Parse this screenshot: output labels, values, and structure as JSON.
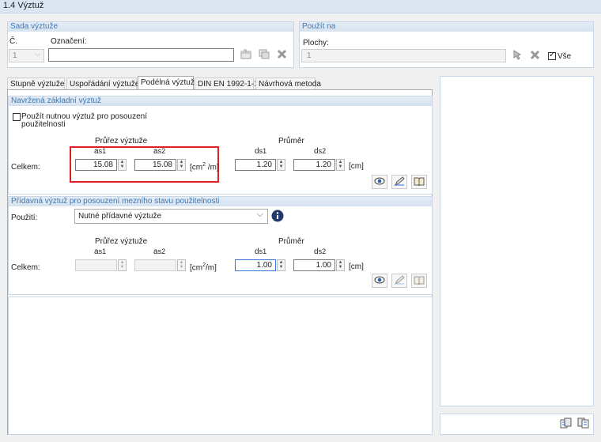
{
  "window": {
    "title": "1.4 Výztuž"
  },
  "set": {
    "header": "Sada výztuže",
    "number_label": "Č.",
    "number_value": "1",
    "designation_label": "Označení:",
    "designation_value": ""
  },
  "apply": {
    "header": "Použít na",
    "surfaces_label": "Plochy:",
    "surfaces_value": "1",
    "all_label": "Vše",
    "all_checked": true
  },
  "tabs": [
    {
      "label": "Stupně výztuže"
    },
    {
      "label": "Uspořádání výztuže"
    },
    {
      "label": "Podélná výztuž"
    },
    {
      "label": "DIN EN 1992-1-1"
    },
    {
      "label": "Návrhová metoda"
    }
  ],
  "active_tab": "Podélná výztuž",
  "basic": {
    "header": "Navržená základní výztuž",
    "use_required_label_1": "Použít nutnou výztuž pro posouzení",
    "use_required_label_2": "použitelnosti",
    "use_required_checked": false,
    "section_label": "Průřez výztuže",
    "diameter_label": "Průměr",
    "as1_main": "a",
    "as1_sub": "s1",
    "as2_main": "a",
    "as2_sub": "s2",
    "ds1_main": "d",
    "ds1_sub": "s1",
    "ds2_main": "d",
    "ds2_sub": "s2",
    "total_label": "Celkem:",
    "as1_value": "15.08",
    "as2_value": "15.08",
    "area_unit_pre": "[cm",
    "area_unit_sup": "2",
    "area_unit_post": " /m]",
    "ds1_value": "1.20",
    "ds2_value": "1.20",
    "diam_unit": "[cm]"
  },
  "additional": {
    "header": "Přídavná výztuž pro posouzení mezního stavu použitelnosti",
    "use_label": "Použití:",
    "use_value": "Nutné přídavné výztuže",
    "section_label": "Průřez výztuže",
    "diameter_label": "Průměr",
    "as1_main": "a",
    "as1_sub": "s1",
    "as2_main": "a",
    "as2_sub": "s2",
    "ds1_main": "d",
    "ds1_sub": "s1",
    "ds2_main": "d",
    "ds2_sub": "s2",
    "total_label": "Celkem:",
    "as1_value": "",
    "as2_value": "",
    "area_unit_pre": "[cm",
    "area_unit_sup": "2",
    "area_unit_post": "/m]",
    "ds1_value": "1.00",
    "ds2_value": "1.00",
    "diam_unit": "[cm]"
  },
  "colors": {
    "header_text": "#3c78b4",
    "highlight": "#e02020",
    "focus": "#3c78d8"
  }
}
